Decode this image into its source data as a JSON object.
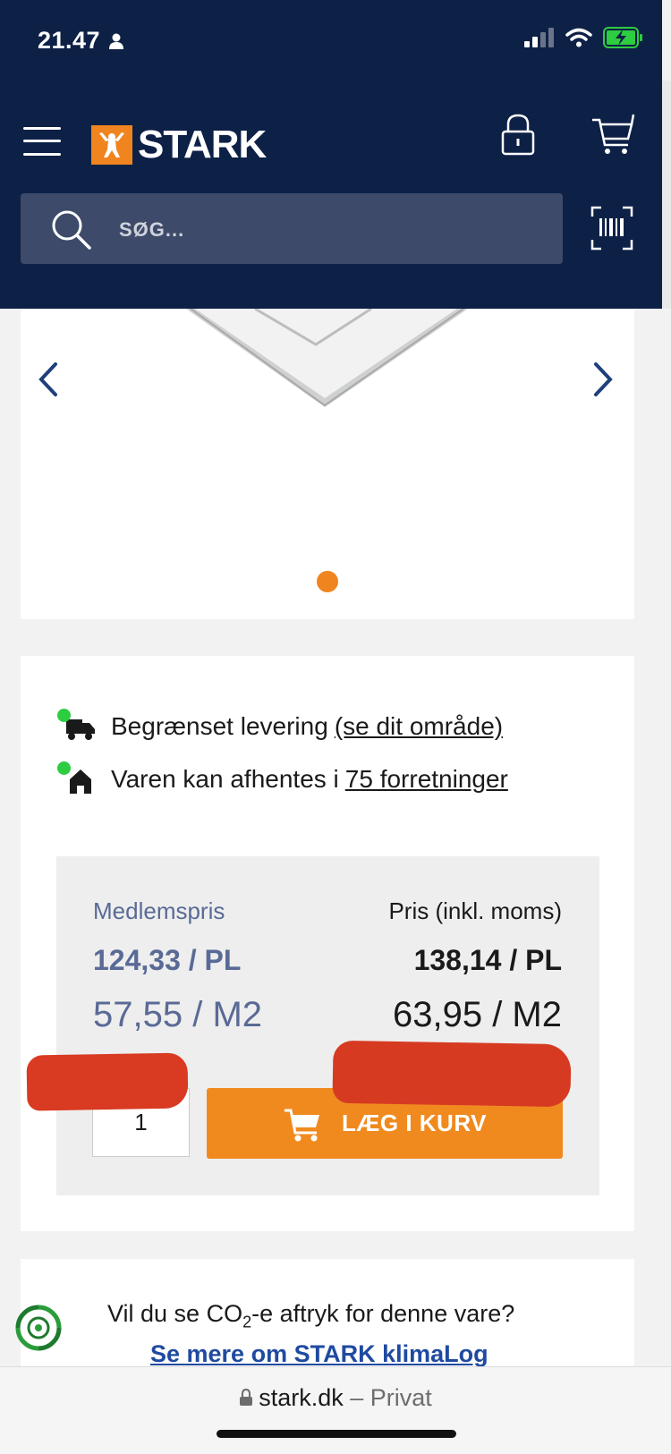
{
  "status_bar": {
    "time": "21.47"
  },
  "header": {
    "logo_text": "STARK",
    "search_placeholder": "SØG..."
  },
  "availability": [
    {
      "text": "Begrænset levering ",
      "link": "(se dit område)",
      "icon": "truck-icon"
    },
    {
      "text": "Varen kan afhentes i ",
      "link": "75 forretninger",
      "icon": "house-icon"
    }
  ],
  "price": {
    "member_label": "Medlemspris",
    "price_label": "Pris (inkl. moms)",
    "member_per_pl": "124,33 / PL",
    "price_per_pl": "138,14 / PL",
    "member_per_m2": "57,55 / M2",
    "price_per_m2": "63,95 / M2"
  },
  "cart": {
    "quantity": "1",
    "add_label": "LÆG I KURV"
  },
  "climate": {
    "question_pre": "Vil du se CO",
    "question_sub": "2",
    "question_post": "-e aftryk for denne vare?",
    "link": "Se mere om STARK klimaLog"
  },
  "browser": {
    "domain": "stark.dk",
    "mode": " – Privat"
  },
  "colors": {
    "header_bg": "#0d2147",
    "accent_orange": "#f0841e",
    "member_blue": "#5a6a96",
    "link_blue": "#1f4aa0",
    "status_green": "#2ecc40"
  }
}
